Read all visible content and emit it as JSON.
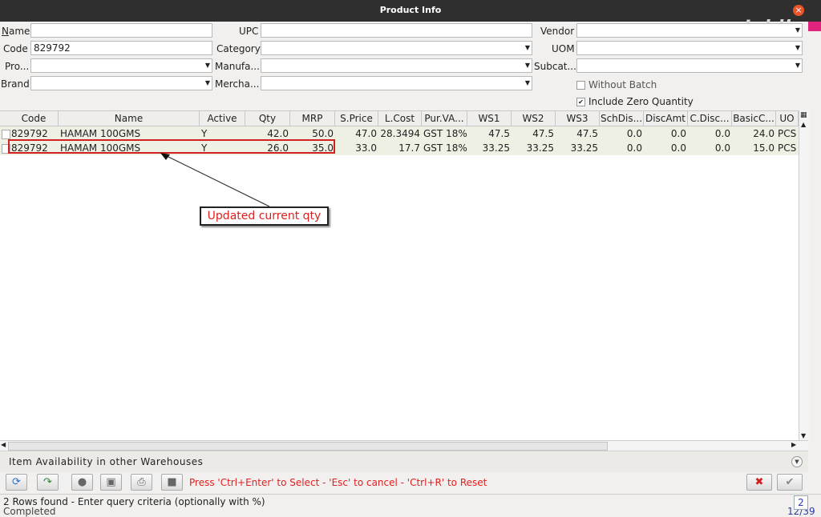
{
  "window": {
    "title": "Product Info",
    "close_glyph": "×",
    "watermark": "Jaldi"
  },
  "filters": {
    "name_label": "Name",
    "code_label": "Code",
    "code_value": "829792",
    "pro_label": "Pro...",
    "brand_label": "Brand",
    "upc_label": "UPC",
    "category_label": "Category",
    "manufa_label": "Manufa...",
    "mercha_label": "Mercha...",
    "vendor_label": "Vendor",
    "uom_label": "UOM",
    "subcat_label": "Subcat...",
    "without_batch_label": "Without Batch",
    "without_batch_checked": false,
    "include_zero_label": "Include Zero Quantity",
    "include_zero_checked": true,
    "include_zero_mark": "✔"
  },
  "table": {
    "columns": [
      "Code",
      "Name",
      "Active",
      "Qty",
      "MRP",
      "S.Price",
      "L.Cost",
      "Pur.VA...",
      "WS1",
      "WS2",
      "WS3",
      "SchDis...",
      "DiscAmt",
      "C.Disc...",
      "BasicC...",
      "UO"
    ],
    "rows": [
      [
        "829792",
        "HAMAM 100GMS",
        "Y",
        "42.0",
        "50.0",
        "47.0",
        "28.3494",
        "GST 18%",
        "47.5",
        "47.5",
        "47.5",
        "0.0",
        "0.0",
        "0.0",
        "24.0",
        "PCS"
      ],
      [
        "829792",
        "HAMAM 100GMS",
        "Y",
        "26.0",
        "35.0",
        "33.0",
        "17.7",
        "GST 18%",
        "33.25",
        "33.25",
        "33.25",
        "0.0",
        "0.0",
        "0.0",
        "15.0",
        "PCS"
      ]
    ]
  },
  "annotation": {
    "callout_text": "Updated current qty"
  },
  "section": {
    "title": "Item Availability in other Warehouses"
  },
  "toolbar": {
    "hint": "Press 'Ctrl+Enter' to Select - 'Esc' to cancel - 'Ctrl+R' to Reset",
    "cancel_glyph": "✖",
    "ok_glyph": "✔"
  },
  "status": {
    "message": "2 Rows found - Enter query criteria (optionally with %)",
    "under_text": "Completed",
    "page": "2",
    "page_suffix": "12/39"
  },
  "colors": {
    "highlight": "#d42020",
    "hint": "#e02020",
    "titlebar": "#2f2f2f",
    "close": "#e9542a",
    "accent_strip": "#e0247d"
  }
}
